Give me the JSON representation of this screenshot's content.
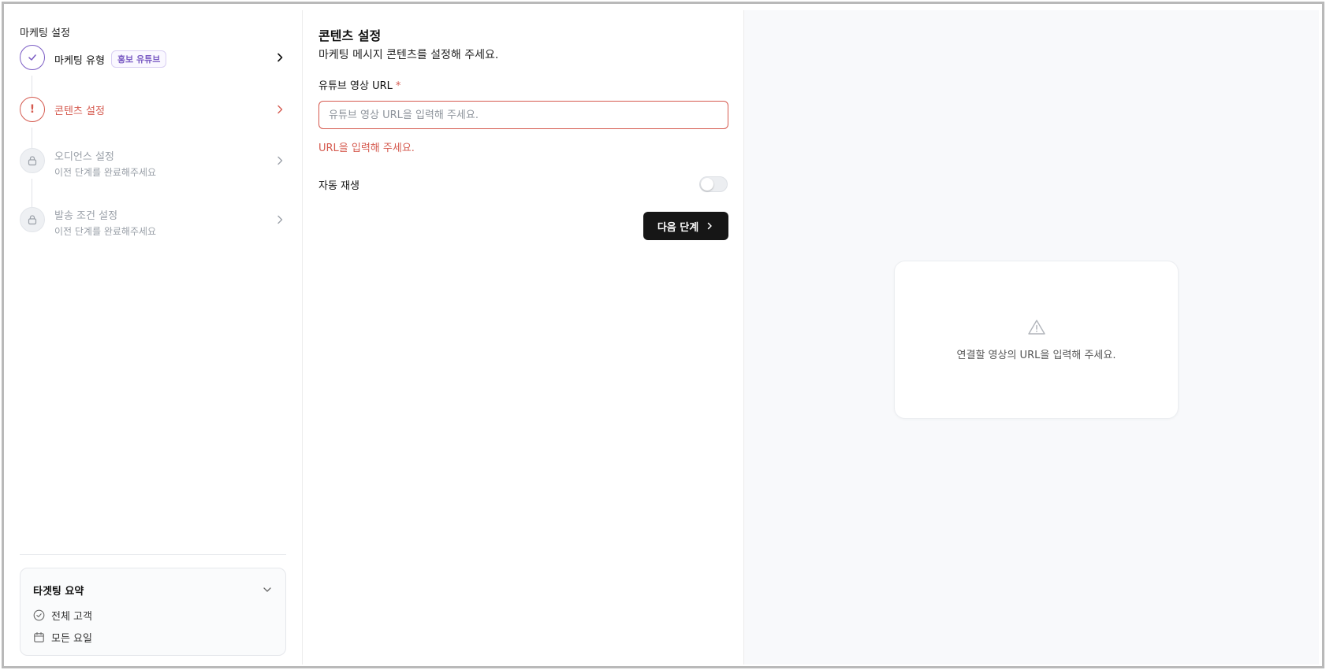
{
  "sidebar": {
    "title": "마케팅 설정",
    "steps": [
      {
        "label": "마케팅 유형",
        "badge": "홍보 유튜브",
        "state": "done"
      },
      {
        "label": "콘텐츠 설정",
        "state": "error",
        "marker": "!"
      },
      {
        "label": "오디언스 설정",
        "sub": "이전 단계를 완료해주세요",
        "state": "locked"
      },
      {
        "label": "발송 조건 설정",
        "sub": "이전 단계를 완료해주세요",
        "state": "locked"
      }
    ],
    "summary": {
      "title": "타겟팅 요약",
      "rows": [
        {
          "icon": "check-circle-icon",
          "text": "전체 고객"
        },
        {
          "icon": "calendar-icon",
          "text": "모든 요일"
        }
      ]
    }
  },
  "main": {
    "title": "콘텐츠 설정",
    "description": "마케팅 메시지 콘텐츠를 설정해 주세요.",
    "url_field": {
      "label": "유튜브 영상 URL",
      "required_mark": "*",
      "value": "",
      "placeholder": "유튜브 영상 URL을 입력해 주세요.",
      "error": "URL을 입력해 주세요."
    },
    "autoplay": {
      "label": "자동 재생",
      "enabled": false
    },
    "next_button": "다음 단계"
  },
  "preview": {
    "message": "연결할 영상의 URL을 입력해 주세요.",
    "icon": "warning-icon"
  },
  "colors": {
    "accent": "#7b5cc4",
    "error": "#d55a4f",
    "button": "#161616",
    "muted": "#9aa0a8"
  }
}
